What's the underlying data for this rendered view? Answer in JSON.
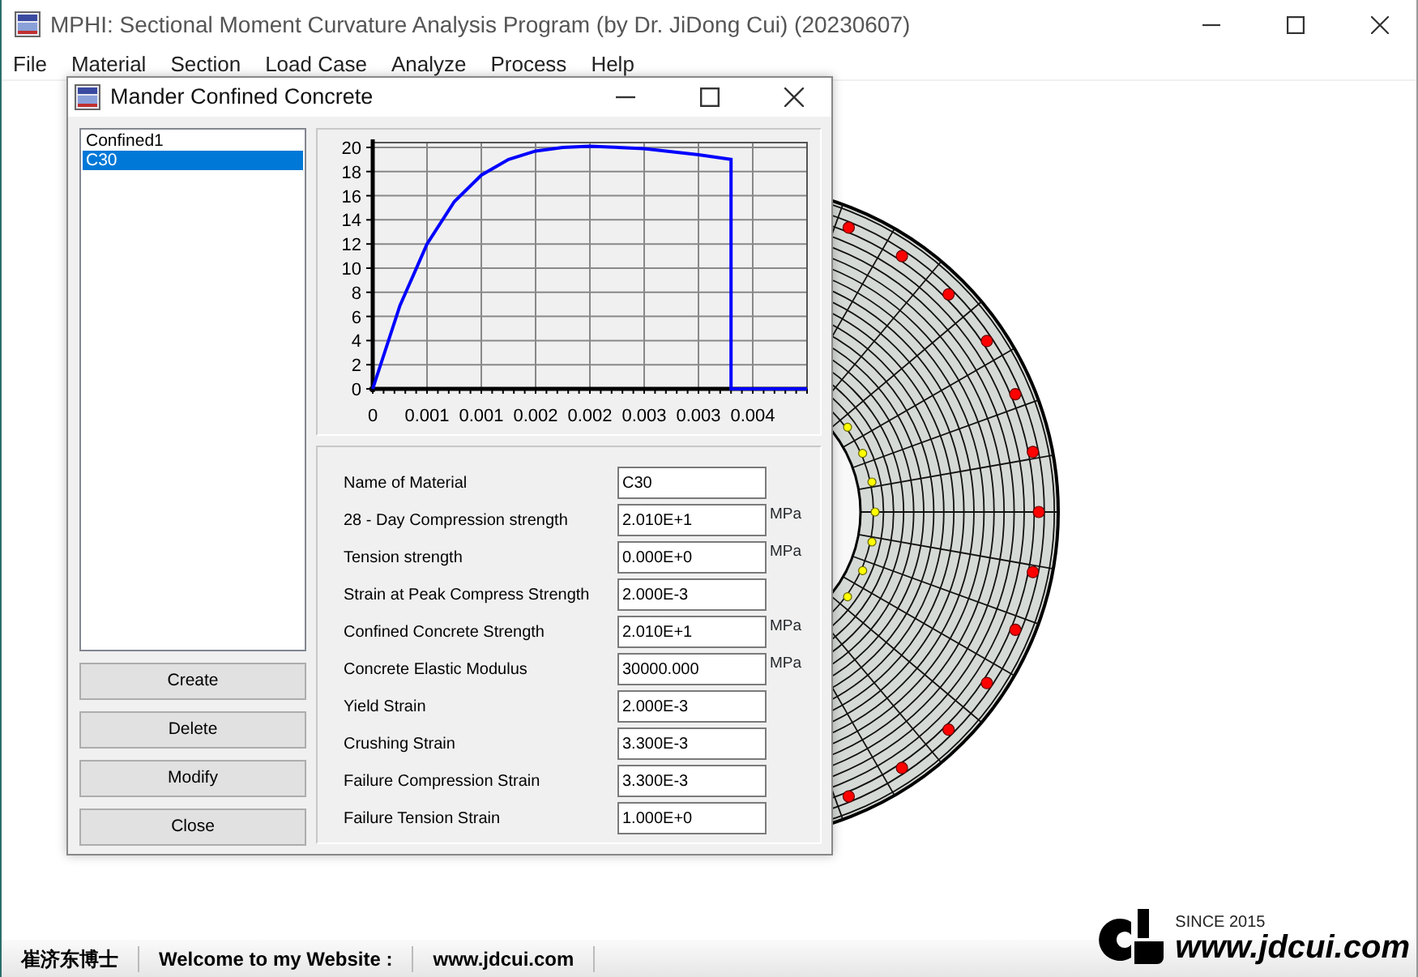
{
  "window": {
    "title": "MPHI: Sectional Moment Curvature Analysis Program (by Dr. JiDong Cui) (20230607)"
  },
  "menu": [
    "File",
    "Material",
    "Section",
    "Load Case",
    "Analyze",
    "Process",
    "Help"
  ],
  "dialog": {
    "title": "Mander Confined Concrete",
    "materials": [
      {
        "label": "Confined1",
        "selected": false
      },
      {
        "label": "C30",
        "selected": true
      }
    ],
    "chart_data": {
      "type": "line",
      "x": [
        0,
        0.00025,
        0.0005,
        0.00075,
        0.001,
        0.00125,
        0.0015,
        0.00175,
        0.002,
        0.0025,
        0.003,
        0.0033,
        0.0033,
        0.004
      ],
      "series": [
        {
          "color": "#0000ff",
          "values": [
            0,
            6.9,
            12,
            15.5,
            17.7,
            19,
            19.7,
            20,
            20.1,
            19.9,
            19.4,
            19,
            0,
            0
          ]
        }
      ],
      "xlim": [
        0,
        0.004
      ],
      "ylim": [
        0,
        20.4
      ],
      "grid": true,
      "xticks": [
        {
          "value": 0,
          "label": "0"
        },
        {
          "value": 0.0005,
          "label": "0.001"
        },
        {
          "value": 0.001,
          "label": "0.001"
        },
        {
          "value": 0.0015,
          "label": "0.002"
        },
        {
          "value": 0.002,
          "label": "0.002"
        },
        {
          "value": 0.0025,
          "label": "0.003"
        },
        {
          "value": 0.003,
          "label": "0.003"
        },
        {
          "value": 0.0035,
          "label": "0.004"
        }
      ],
      "yticks": [
        0,
        2,
        4,
        6,
        8,
        10,
        12,
        14,
        16,
        18,
        20
      ]
    },
    "fields": [
      {
        "label": "Name of Material",
        "value": "C30"
      },
      {
        "label": "28 - Day Compression strength",
        "value": "2.010E+1",
        "unit": "MPa"
      },
      {
        "label": "Tension strength",
        "value": "0.000E+0",
        "unit": "MPa"
      },
      {
        "label": "Strain at Peak Compress Strength",
        "value": "2.000E-3"
      },
      {
        "label": "Confined Concrete Strength",
        "value": "2.010E+1",
        "unit": "MPa"
      },
      {
        "label": "Concrete Elastic Modulus",
        "value": "30000.000",
        "unit": "MPa"
      },
      {
        "label": "Yield Strain",
        "value": "2.000E-3"
      },
      {
        "label": "Crushing Strain",
        "value": "3.300E-3"
      },
      {
        "label": "Failure Compression Strain",
        "value": "3.300E-3"
      },
      {
        "label": "Failure Tension Strain",
        "value": "1.000E+0"
      }
    ],
    "buttons": [
      "Create",
      "Delete",
      "Modify",
      "Close"
    ]
  },
  "status_bar": [
    "崔济东博士",
    "Welcome to my Website :",
    "www.jdcui.com"
  ],
  "logo": {
    "since": "SINCE 2015",
    "url": "www.jdcui.com"
  }
}
